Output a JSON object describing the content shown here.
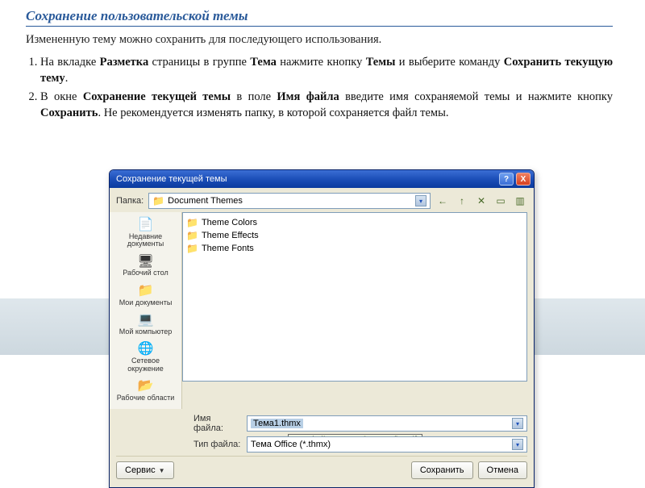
{
  "heading": "Сохранение пользовательской темы",
  "intro": "Измененную тему можно сохранить для последующего использования.",
  "steps": {
    "one_a": "На вкладке ",
    "one_b": "Разметка",
    "one_c": " страницы в группе ",
    "one_d": "Тема",
    "one_e": " нажмите кнопку ",
    "one_f": "Темы",
    "one_g": " и выберите команду ",
    "one_h": "Сохранить текущую тему",
    "one_i": ".",
    "two_a": "В окне ",
    "two_b": "Сохранение текущей темы",
    "two_c": " в поле ",
    "two_d": "Имя файла",
    "two_e": " введите имя сохраняемой темы и нажмите кнопку ",
    "two_f": "Сохранить",
    "two_g": ". Не рекомендуется изменять папку, в которой сохраняется файл темы."
  },
  "dialog": {
    "title": "Сохранение текущей темы",
    "help": "?",
    "close": "X",
    "folder_label": "Папка:",
    "folder_value": "Document Themes",
    "toolbar_icons": {
      "back": "←",
      "up": "↑",
      "delete": "✕",
      "new": "▭",
      "views": "▥"
    },
    "places": [
      {
        "icon": "📄",
        "label": "Недавние документы"
      },
      {
        "icon": "🖥",
        "label": "Рабочий стол"
      },
      {
        "icon": "📁",
        "label": "Мои документы"
      },
      {
        "icon": "💻",
        "label": "Мой компьютер"
      },
      {
        "icon": "🌐",
        "label": "Сетевое окружение"
      },
      {
        "icon": "📂",
        "label": "Рабочие области"
      }
    ],
    "files": [
      "Theme Colors",
      "Theme Effects",
      "Theme Fonts"
    ],
    "filename_label": "Имя файла:",
    "filename_value": "Тема1.thmx",
    "filename_tooltip": "Имя файла или веб-адрес (http://)",
    "filetype_label": "Тип файла:",
    "filetype_value": "Тема Office (*.thmx)",
    "tools_btn": "Сервис",
    "save_btn": "Сохранить",
    "cancel_btn": "Отмена"
  }
}
